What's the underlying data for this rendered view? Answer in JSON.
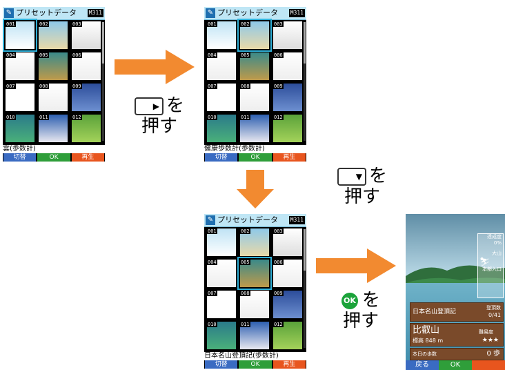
{
  "screens": {
    "title": "プリセットデータ",
    "badge": "M311",
    "numbers": [
      "001",
      "002",
      "003",
      "004",
      "005",
      "006",
      "007",
      "008",
      "009",
      "010",
      "011",
      "012"
    ],
    "softkeys": {
      "left": "切替",
      "center": "OK",
      "right": "再生"
    },
    "screen1": {
      "caption": "雲(歩数計)"
    },
    "screen2": {
      "caption": "健康歩数計(歩数計)"
    },
    "screen3": {
      "caption": "日本名山登頂記(歩数計)"
    }
  },
  "instructions": {
    "step1": {
      "suffix": "を",
      "action": "押す",
      "key_icon": "right-key-icon"
    },
    "step2": {
      "suffix": "を",
      "action": "押す",
      "key_icon": "down-key-icon"
    },
    "step3": {
      "key_label": "OK",
      "suffix": "を",
      "action": "押す"
    }
  },
  "final_screen": {
    "side_progress_label": "達成度",
    "side_progress_value": "0%",
    "side_top_label": "大山",
    "side_bottom_label": "本部入口",
    "game_title": "日本名山登頂記",
    "count_label": "登頂数",
    "count_value": "0/41",
    "mountain_name": "比叡山",
    "difficulty_label": "難易度",
    "difficulty_stars": "★★★",
    "elevation": "標高 848 m",
    "steps_label": "本日の歩数",
    "steps_value": "0 歩",
    "softkeys": {
      "left": "戻る",
      "center": "OK",
      "right": ""
    }
  },
  "colors": {
    "arrow": "#f28a30",
    "select": "#2fb0d8",
    "sk_left": "#3a6bc2",
    "sk_center": "#2f9e3a",
    "sk_right": "#e8551e"
  }
}
